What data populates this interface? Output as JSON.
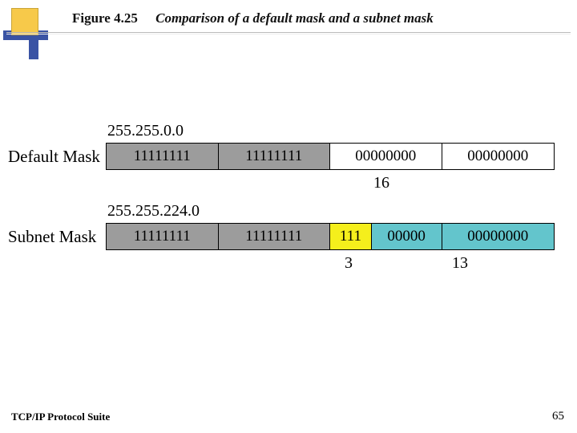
{
  "header": {
    "figure_no": "Figure 4.25",
    "caption": "Comparison of a default mask and a subnet mask"
  },
  "default_mask": {
    "label": "Default Mask",
    "dotted": "255.255.0.0",
    "segs": [
      "11111111",
      "11111111",
      "00000000",
      "00000000"
    ],
    "count_right": "16"
  },
  "subnet_mask": {
    "label": "Subnet Mask",
    "dotted": "255.255.224.0",
    "segs": [
      "11111111",
      "11111111",
      "111",
      "00000",
      "00000000"
    ],
    "count_mid": "3",
    "count_right": "13"
  },
  "footer": {
    "left": "TCP/IP Protocol Suite",
    "page": "65"
  }
}
